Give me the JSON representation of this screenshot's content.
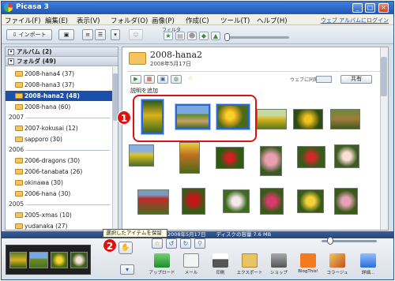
{
  "window": {
    "title": "Picasa 3"
  },
  "menu": {
    "items": [
      "ファイル(F)",
      "編集(E)",
      "表示(V)",
      "フォルダ(O)",
      "画像(P)",
      "作成(C)",
      "ツール(T)",
      "ヘルプ(H)"
    ],
    "web_login": "ウェブ アルバムにログイン"
  },
  "toolbar": {
    "import_label": "インポート",
    "filter_label": "フィルタ"
  },
  "left_panel": {
    "albums_header": "アルバム (2)",
    "folders_header": "フォルダ (49)",
    "year_2008_items": [
      "2008-hana4 (37)",
      "2008-hana3 (37)",
      "2008-hana2 (48)",
      "2008-hana (60)"
    ],
    "selected_index": 2,
    "group_2007": "2007",
    "year_2007_items": [
      "2007-kokusai (12)",
      "sapporo (30)"
    ],
    "group_2006": "2006",
    "year_2006_items": [
      "2006-dragons (30)",
      "2006-tanabata (26)",
      "okinawa (30)",
      "2006-hana (30)"
    ],
    "group_2005": "2005",
    "year_2005_items": [
      "2005-xmas (10)",
      "yudanaka (27)"
    ]
  },
  "album": {
    "title": "2008-hana2",
    "date": "2008年5月17日",
    "add_description": "説明を追加",
    "web_share_label": "ウェブに同期",
    "share_label": "共有"
  },
  "callouts": {
    "one": "1",
    "two": "2"
  },
  "status": {
    "text": "2008年5月17日　　ディスクの容量 7.6 MB"
  },
  "tray": {
    "hold_tooltip": "選択したアイテムを保留"
  },
  "actions": {
    "labels": [
      "アップロード",
      "メール",
      "印刷",
      "エクスポート",
      "ショップ",
      "BlogThis!",
      "コラージュ",
      "詳細..."
    ]
  },
  "colors": {
    "title_bar": "#1f55b8",
    "selected_folder": "#1c4fa8",
    "highlight": "#e01010"
  }
}
